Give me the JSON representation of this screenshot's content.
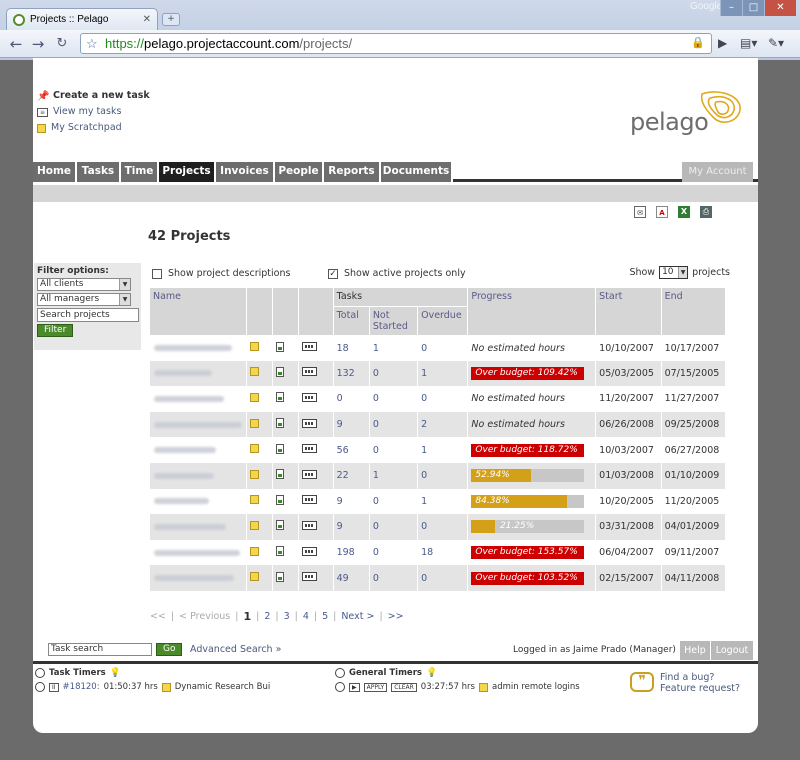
{
  "browser": {
    "tab_title": "Projects :: Pelago",
    "new_tab": "+",
    "google_label": "Google",
    "url_scheme": "https://",
    "url_host": "pelago.projectaccount.com",
    "url_path": "/projects/"
  },
  "toplinks": {
    "create": "Create a new task",
    "view": "View my tasks",
    "scratchpad": "My Scratchpad"
  },
  "logo": {
    "text": "pelago"
  },
  "nav": {
    "items": [
      "Home",
      "Tasks",
      "Time",
      "Projects",
      "Invoices",
      "People",
      "Reports",
      "Documents"
    ],
    "active": "Projects",
    "my_account": "My Account"
  },
  "page_title": "42 Projects",
  "filter": {
    "label": "Filter options:",
    "clients": "All clients",
    "managers": "All managers",
    "search": "Search projects",
    "button": "Filter"
  },
  "options": {
    "show_descriptions": "Show project descriptions",
    "show_active": "Show active projects only",
    "show_label": "Show",
    "show_value": "10",
    "projects_label": "projects"
  },
  "table": {
    "headers": {
      "name": "Name",
      "tasks": "Tasks",
      "total": "Total",
      "not_started": "Not Started",
      "overdue": "Overdue",
      "progress": "Progress",
      "start": "Start",
      "end": "End"
    },
    "rows": [
      {
        "total": "18",
        "not_started": "1",
        "overdue": "0",
        "progress_type": "none",
        "progress_text": "No estimated hours",
        "progress_value": 0,
        "start": "10/10/2007",
        "end": "10/17/2007"
      },
      {
        "total": "132",
        "not_started": "0",
        "overdue": "1",
        "progress_type": "over",
        "progress_text": "Over budget: 109.42%",
        "progress_value": 100,
        "start": "05/03/2005",
        "end": "07/15/2005"
      },
      {
        "total": "0",
        "not_started": "0",
        "overdue": "0",
        "progress_type": "none",
        "progress_text": "No estimated hours",
        "progress_value": 0,
        "start": "11/20/2007",
        "end": "11/27/2007"
      },
      {
        "total": "9",
        "not_started": "0",
        "overdue": "2",
        "progress_type": "none",
        "progress_text": "No estimated hours",
        "progress_value": 0,
        "start": "06/26/2008",
        "end": "09/25/2008"
      },
      {
        "total": "56",
        "not_started": "0",
        "overdue": "1",
        "progress_type": "over",
        "progress_text": "Over budget: 118.72%",
        "progress_value": 100,
        "start": "10/03/2007",
        "end": "06/27/2008"
      },
      {
        "total": "22",
        "not_started": "1",
        "overdue": "0",
        "progress_type": "normal",
        "progress_text": "52.94%",
        "progress_value": 52.94,
        "start": "01/03/2008",
        "end": "01/10/2009"
      },
      {
        "total": "9",
        "not_started": "0",
        "overdue": "1",
        "progress_type": "normal",
        "progress_text": "84.38%",
        "progress_value": 84.38,
        "start": "10/20/2005",
        "end": "11/20/2005"
      },
      {
        "total": "9",
        "not_started": "0",
        "overdue": "0",
        "progress_type": "normal",
        "progress_text": "21.25%",
        "progress_value": 21.25,
        "start": "03/31/2008",
        "end": "04/01/2009"
      },
      {
        "total": "198",
        "not_started": "0",
        "overdue": "18",
        "progress_type": "over",
        "progress_text": "Over budget: 153.57%",
        "progress_value": 100,
        "start": "06/04/2007",
        "end": "09/11/2007"
      },
      {
        "total": "49",
        "not_started": "0",
        "overdue": "0",
        "progress_type": "over",
        "progress_text": "Over budget: 103.52%",
        "progress_value": 100,
        "start": "02/15/2007",
        "end": "04/11/2008"
      }
    ]
  },
  "pager": {
    "first": "<<",
    "prev": "< Previous",
    "pages": [
      "1",
      "2",
      "3",
      "4",
      "5"
    ],
    "current": "1",
    "next": "Next >",
    "last": ">>"
  },
  "bottom": {
    "task_search": "Task search",
    "go": "Go",
    "advanced": "Advanced Search »",
    "logged_in": "Logged in as Jaime Prado (Manager)",
    "help": "Help",
    "logout": "Logout"
  },
  "timers": {
    "task_title": "Task Timers",
    "task_id": "#18120:",
    "task_time": "01:50:37 hrs",
    "task_name": "Dynamic Research Bui",
    "general_title": "General Timers",
    "apply": "APPLY",
    "clear": "CLEAR",
    "general_time": "03:27:57 hrs",
    "general_name": "admin remote logins",
    "bug": "Find a bug?",
    "feature": "Feature request?"
  },
  "colors": {
    "over_budget": "#cc0000",
    "progress_fill": "#d4a017",
    "nav_bg": "#6d6d6d",
    "nav_active": "#1f1f1f",
    "filter_button": "#4a8a2a"
  }
}
